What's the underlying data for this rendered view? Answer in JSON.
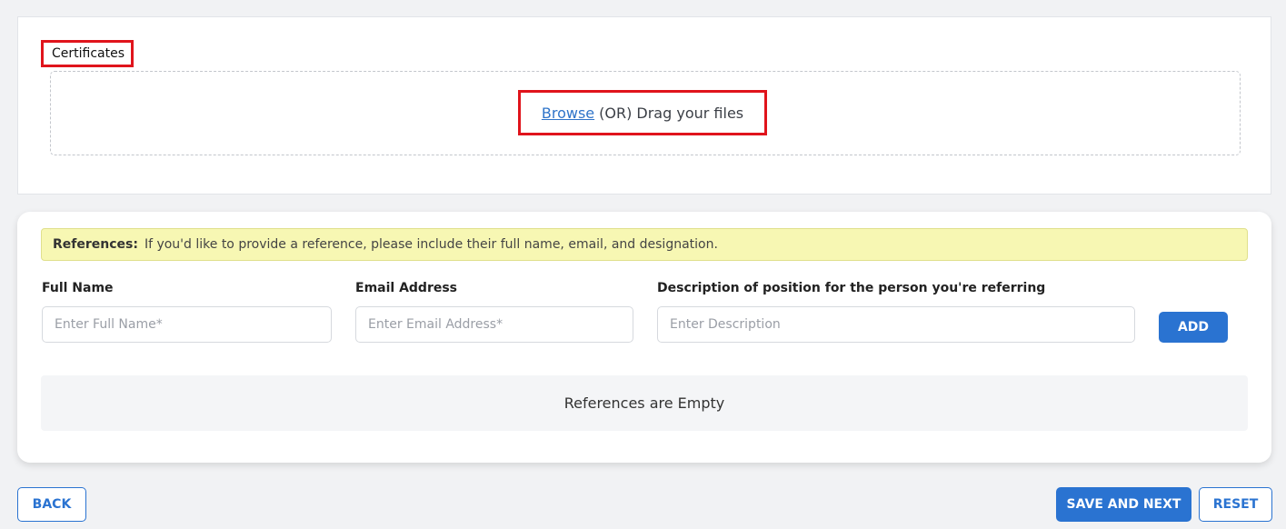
{
  "certificates": {
    "label": "Certificates",
    "browse_label": "Browse",
    "drag_label": "(OR) Drag your files"
  },
  "references": {
    "notice_title": "References:",
    "notice_text": "If you'd like to provide a reference, please include their full name, email, and designation.",
    "full_name_label": "Full Name",
    "full_name_placeholder": "Enter Full Name*",
    "full_name_value": "",
    "email_label": "Email Address",
    "email_placeholder": "Enter Email Address*",
    "email_value": "",
    "description_label": "Description of position for the person you're referring",
    "description_placeholder": "Enter Description",
    "description_value": "",
    "add_label": "ADD",
    "empty_text": "References are Empty"
  },
  "footer": {
    "back_label": "BACK",
    "save_next_label": "SAVE AND NEXT",
    "reset_label": "RESET"
  },
  "colors": {
    "accent": "#2a73d1",
    "highlight_border": "#e0141c",
    "notice_bg": "#f7f7b3"
  }
}
